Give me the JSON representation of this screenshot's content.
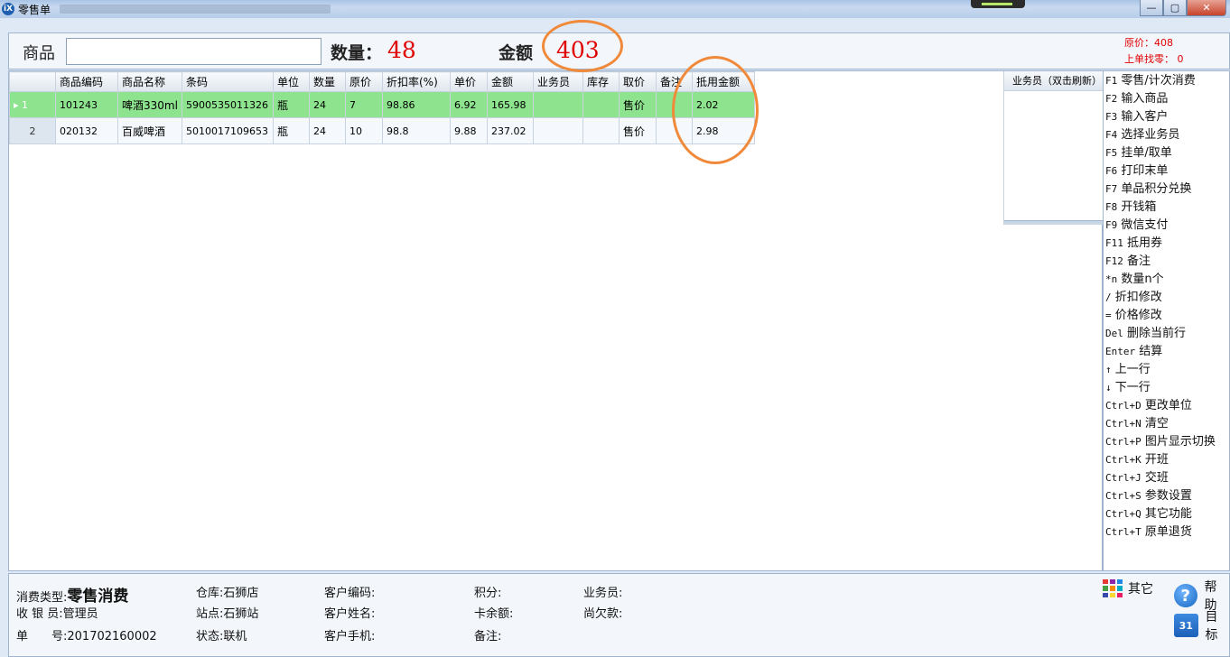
{
  "window": {
    "title": "零售单",
    "app_icon_text": "iX",
    "minimize": "—",
    "maximize": "▢",
    "close": "✕"
  },
  "topbar": {
    "product_label": "商品",
    "qty_label": "数量：",
    "qty_value": "48",
    "amount_label": "金额",
    "amount_value": "403",
    "orig_price": "原价：408",
    "last_change": "上单找零： 0"
  },
  "grid": {
    "columns": [
      "",
      "商品编码",
      "商品名称",
      "条码",
      "单位",
      "数量",
      "原价",
      "折扣率(%)",
      "单价",
      "金额",
      "业务员",
      "库存",
      "取价",
      "备注",
      "抵用金额"
    ],
    "rows": [
      {
        "indicator": "▸ 1",
        "code": "101243",
        "name": "啤酒330ml",
        "barcode": "5900535011326",
        "unit": "瓶",
        "qty": "24",
        "orig": "7",
        "discount": "98.86",
        "price": "6.92",
        "amount": "165.98",
        "sales": "",
        "stock": "",
        "pricing": "售价",
        "note": "",
        "voucher": "2.02"
      },
      {
        "indicator": "2",
        "code": "020132",
        "name": "百威啤酒",
        "barcode": "5010017109653",
        "unit": "瓶",
        "qty": "24",
        "orig": "10",
        "discount": "98.8",
        "price": "9.88",
        "amount": "237.02",
        "sales": "",
        "stock": "",
        "pricing": "售价",
        "note": "",
        "voucher": "2.98"
      }
    ]
  },
  "salesperson_panel": {
    "header": "业务员（双击刷新）"
  },
  "shortcuts": [
    {
      "key": "F1",
      "label": "零售/计次消费"
    },
    {
      "key": "F2",
      "label": "输入商品"
    },
    {
      "key": "F3",
      "label": "输入客户"
    },
    {
      "key": "F4",
      "label": "选择业务员"
    },
    {
      "key": "F5",
      "label": "挂单/取单"
    },
    {
      "key": "F6",
      "label": "打印末单"
    },
    {
      "key": "F7",
      "label": "单品积分兑换"
    },
    {
      "key": "F8",
      "label": "开钱箱"
    },
    {
      "key": "F9",
      "label": "微信支付"
    },
    {
      "key": "F11",
      "label": "抵用券"
    },
    {
      "key": "F12",
      "label": "备注"
    },
    {
      "key": "*n",
      "label": "数量n个"
    },
    {
      "key": "/",
      "label": "折扣修改"
    },
    {
      "key": "=",
      "label": "价格修改"
    },
    {
      "key": "Del",
      "label": "删除当前行"
    },
    {
      "key": "Enter",
      "label": "结算"
    },
    {
      "key": "↑",
      "label": "上一行"
    },
    {
      "key": "↓",
      "label": "下一行"
    },
    {
      "key": "Ctrl+D",
      "label": "更改单位"
    },
    {
      "key": "Ctrl+N",
      "label": "清空"
    },
    {
      "key": "Ctrl+P",
      "label": "图片显示切换"
    },
    {
      "key": "Ctrl+K",
      "label": "开班"
    },
    {
      "key": "Ctrl+J",
      "label": "交班"
    },
    {
      "key": "Ctrl+S",
      "label": "参数设置"
    },
    {
      "key": "Ctrl+Q",
      "label": "其它功能"
    },
    {
      "key": "Ctrl+T",
      "label": "原单退货"
    }
  ],
  "bottom": {
    "consume_type_label": "消费类型:",
    "consume_type_value": "零售消费",
    "cashier": "收 银 员:管理员",
    "order_no": "单　　号:201702160002",
    "warehouse": "仓库:石狮店",
    "station": "站点:石狮站",
    "status": "状态:联机",
    "cust_code": "客户编码:",
    "cust_name": "客户姓名:",
    "cust_phone": "客户手机:",
    "points": "积分:",
    "card_balance": "卡余额:",
    "remark": "备注:",
    "salesperson": "业务员:",
    "debt": "尚欠款:",
    "other_label": "其它",
    "help_label": "帮助",
    "target_label": "目标",
    "cal_icon_text": "31"
  },
  "colors": {
    "selected_row": "#8ee38e",
    "highlight_red": "#e00000",
    "annotation_orange": "#f08a3a"
  }
}
